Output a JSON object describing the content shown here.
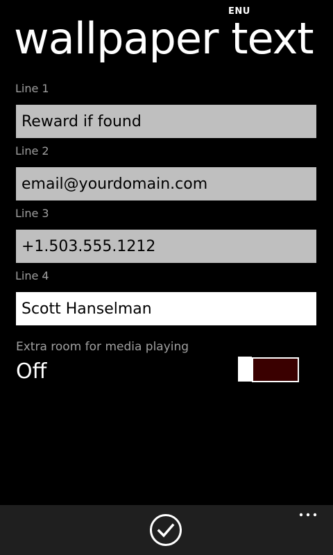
{
  "status_bar": {
    "input_language": "ENU"
  },
  "page": {
    "title": "wallpaper text"
  },
  "fields": [
    {
      "label": "Line 1",
      "value": "Reward if found"
    },
    {
      "label": "Line 2",
      "value": "email@yourdomain.com"
    },
    {
      "label": "Line 3",
      "value": "+1.503.555.1212"
    },
    {
      "label": "Line 4",
      "value": "Scott Hanselman"
    }
  ],
  "media_toggle": {
    "label": "Extra room for media playing",
    "state": "Off",
    "on": false
  },
  "app_bar": {
    "primary_icon": "check-icon",
    "more_icon": "ellipsis-icon"
  },
  "colors": {
    "background": "#000000",
    "field_inactive": "#bfbfbf",
    "field_focused": "#ffffff",
    "toggle_track_fill": "#3a0000",
    "app_bar": "#1f1f1f"
  }
}
